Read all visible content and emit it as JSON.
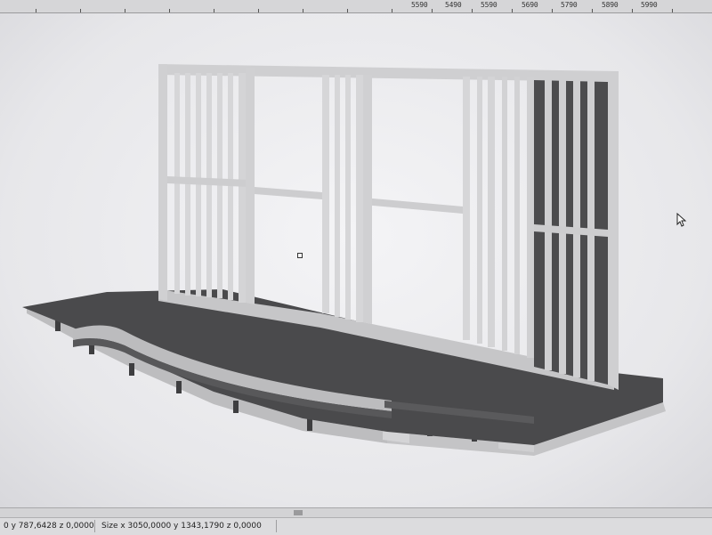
{
  "ruler": {
    "labels": [
      "5590",
      "5490",
      "5590",
      "5690",
      "5790",
      "5890",
      "5990"
    ]
  },
  "viewport": {
    "model_name": "stage-3d-model",
    "cursor_icon": "arrow-cursor-icon"
  },
  "status": {
    "cursor_coords": "0 y 787,6428 z 0,0000",
    "size_readout": "Size x 3050,0000 y 1343,1790 z 0,0000"
  },
  "colors": {
    "platform_top": "#4a4a4c",
    "platform_side": "#c2c2c4",
    "frame_light": "#d0d0d2",
    "frame_dark": "#4c4c4e"
  }
}
